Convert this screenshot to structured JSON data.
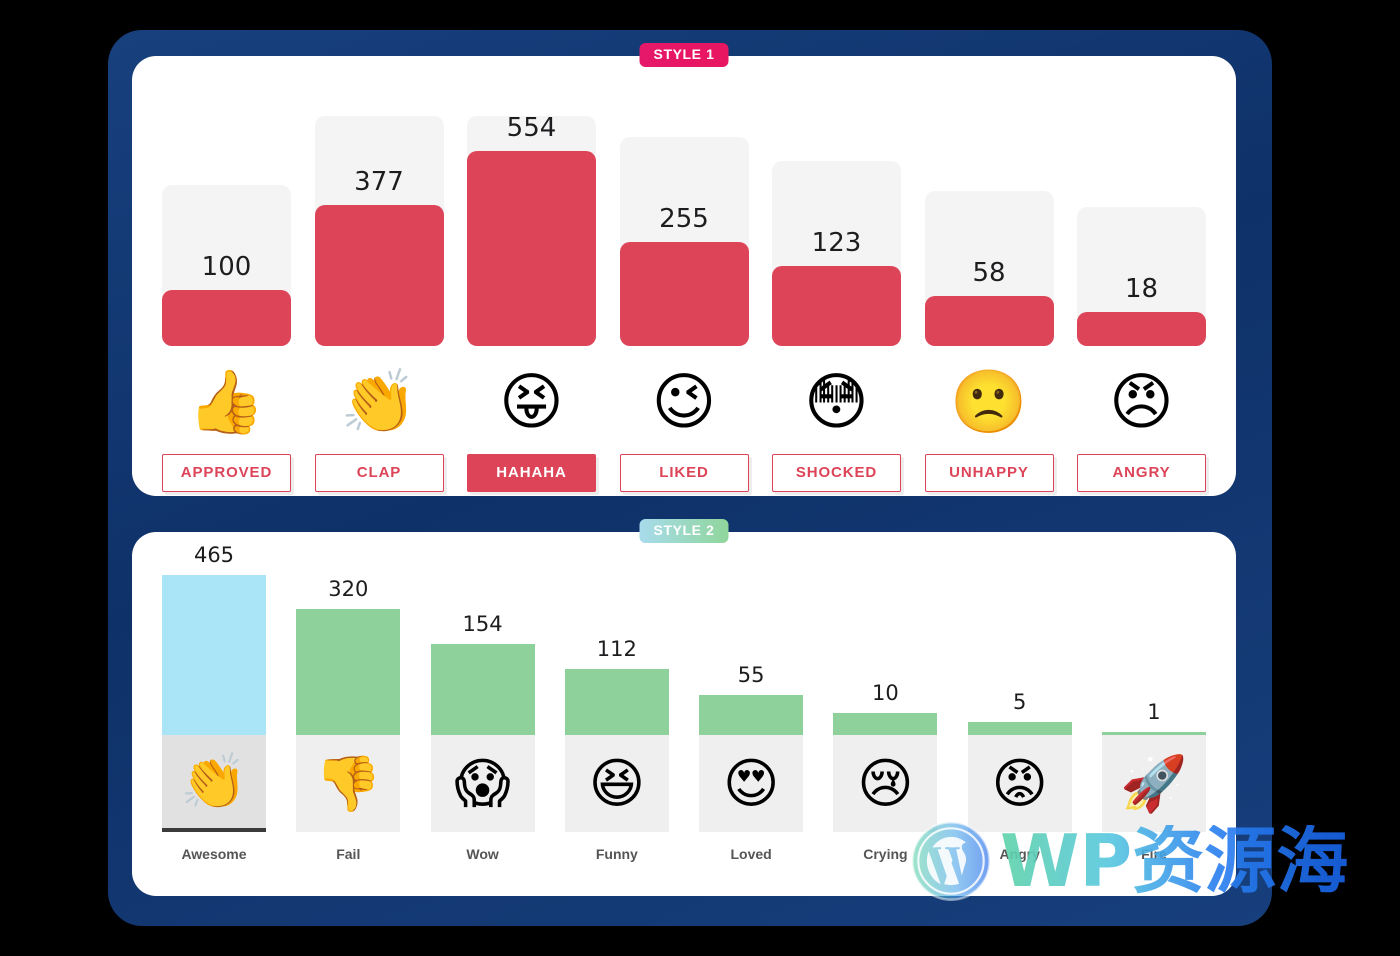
{
  "page": {
    "background_color": "#000000",
    "frame_color": "#123a73"
  },
  "style1": {
    "badge": "STYLE 1",
    "accent_color": "#dd4458",
    "track_color": "#f4f4f5",
    "badge_color": "#e8145f",
    "active_button_index": 2,
    "reactions": [
      {
        "label": "APPROVED",
        "value": "100",
        "emoji": "👍",
        "icon": "thumbs-up-emoji",
        "pct": 18
      },
      {
        "label": "CLAP",
        "value": "377",
        "emoji": "👏",
        "icon": "clapping-hands-emoji",
        "pct": 68
      },
      {
        "label": "HAHAHA",
        "value": "554",
        "emoji": "😝",
        "icon": "squinting-tongue-emoji",
        "pct": 100
      },
      {
        "label": "LIKED",
        "value": "255",
        "emoji": "😉",
        "icon": "winking-face-emoji",
        "pct": 46
      },
      {
        "label": "SHOCKED",
        "value": "123",
        "emoji": "😳",
        "icon": "flushed-face-emoji",
        "pct": 32
      },
      {
        "label": "UNHAPPY",
        "value": "58",
        "emoji": "🙁",
        "icon": "frowning-face-emoji",
        "pct": 14
      },
      {
        "label": "ANGRY",
        "value": "18",
        "emoji": "😠",
        "icon": "angry-face-emoji",
        "pct": 5
      }
    ]
  },
  "style2": {
    "badge": "STYLE 2",
    "bar_color": "#8ed19a",
    "selected_bar_color": "#a9e4f7",
    "emoji_box_color": "#efefef",
    "badge_gradient_from": "#a8dbec",
    "badge_gradient_to": "#8fd69b",
    "selected_index": 0,
    "reactions": [
      {
        "label": "Awesome",
        "value": "465",
        "emoji": "👏",
        "icon": "clapping-hands-emoji",
        "pct": 100,
        "selected": true
      },
      {
        "label": "Fail",
        "value": "320",
        "emoji": "👎",
        "icon": "thumbs-down-emoji",
        "pct": 79
      },
      {
        "label": "Wow",
        "value": "154",
        "emoji": "😱",
        "icon": "screaming-face-emoji",
        "pct": 57
      },
      {
        "label": "Funny",
        "value": "112",
        "emoji": "😆",
        "icon": "grinning-squinting-emoji",
        "pct": 41
      },
      {
        "label": "Loved",
        "value": "55",
        "emoji": "😍",
        "icon": "heart-eyes-emoji",
        "pct": 25
      },
      {
        "label": "Crying",
        "value": "10",
        "emoji": "😢",
        "icon": "crying-face-emoji",
        "pct": 14
      },
      {
        "label": "Angry",
        "value": "5",
        "emoji": "😡",
        "icon": "pouting-face-emoji",
        "pct": 8
      },
      {
        "label": "Fire",
        "value": "1",
        "emoji": "🚀",
        "icon": "rocket-emoji",
        "pct": 2
      }
    ]
  },
  "watermark": {
    "text": "WP资源海",
    "logo": "wordpress-logo"
  },
  "chart_data": [
    {
      "type": "bar",
      "title": "STYLE 1",
      "categories": [
        "APPROVED",
        "CLAP",
        "HAHAHA",
        "LIKED",
        "SHOCKED",
        "UNHAPPY",
        "ANGRY"
      ],
      "values": [
        100,
        377,
        554,
        255,
        123,
        58,
        18
      ],
      "series": [
        {
          "name": "Reactions",
          "values": [
            100,
            377,
            554,
            255,
            123,
            58,
            18
          ]
        }
      ],
      "xlabel": "",
      "ylabel": "",
      "ylim": [
        0,
        554
      ],
      "grid": false,
      "legend": "none",
      "bar_color": "#dd4458",
      "track_color": "#f4f4f5",
      "data_labels": [
        "100",
        "377",
        "554",
        "255",
        "123",
        "58",
        "18"
      ]
    },
    {
      "type": "bar",
      "title": "STYLE 2",
      "categories": [
        "Awesome",
        "Fail",
        "Wow",
        "Funny",
        "Loved",
        "Crying",
        "Angry",
        "Fire"
      ],
      "values": [
        465,
        320,
        154,
        112,
        55,
        10,
        5,
        1
      ],
      "series": [
        {
          "name": "Reactions",
          "values": [
            465,
            320,
            154,
            112,
            55,
            10,
            5,
            1
          ]
        }
      ],
      "xlabel": "",
      "ylabel": "",
      "ylim": [
        0,
        465
      ],
      "grid": false,
      "legend": "none",
      "bar_color": "#8ed19a",
      "highlight_color": "#a9e4f7",
      "highlight_category": "Awesome",
      "data_labels": [
        "465",
        "320",
        "154",
        "112",
        "55",
        "10",
        "5",
        "1"
      ]
    }
  ]
}
